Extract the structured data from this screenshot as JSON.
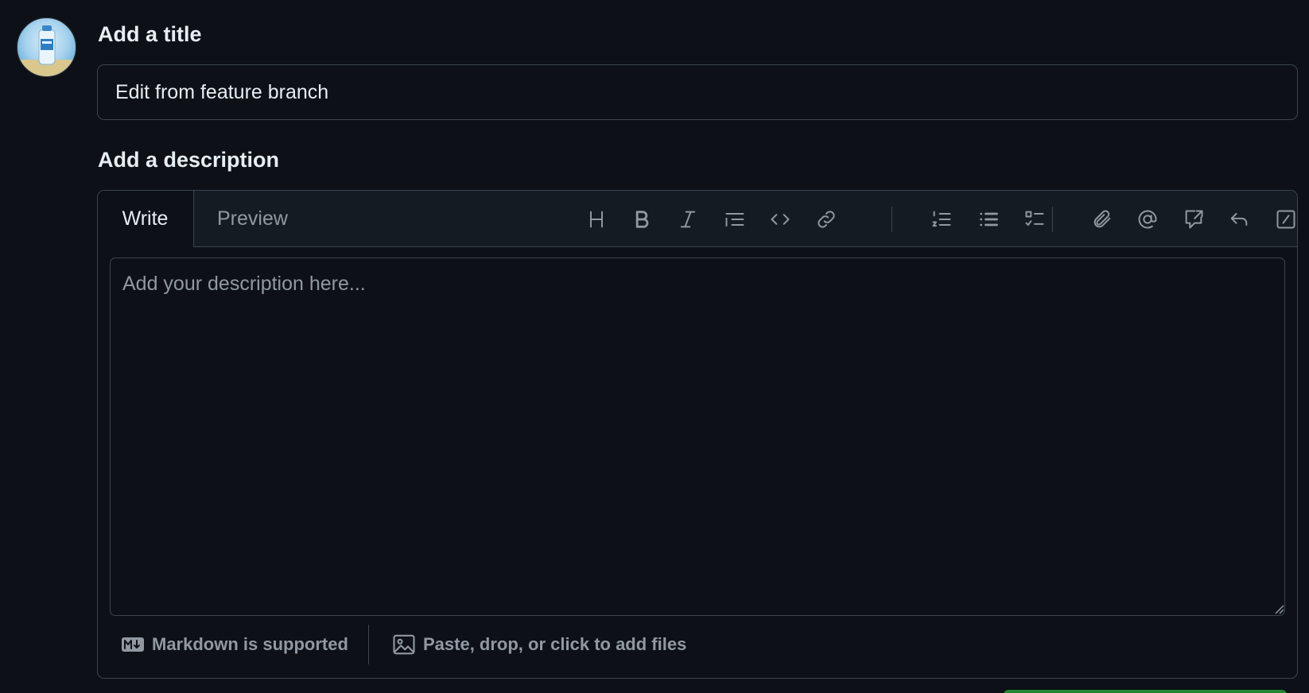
{
  "avatar": {
    "alt": "User avatar"
  },
  "title_section": {
    "heading": "Add a title",
    "value": "Edit from feature branch"
  },
  "description_section": {
    "heading": "Add a description",
    "tabs": [
      {
        "label": "Write",
        "active": true
      },
      {
        "label": "Preview",
        "active": false
      }
    ],
    "toolbar": [
      {
        "name": "heading-icon",
        "title": "Heading"
      },
      {
        "name": "bold-icon",
        "title": "Bold"
      },
      {
        "name": "italic-icon",
        "title": "Italic"
      },
      {
        "name": "quote-icon",
        "title": "Quote"
      },
      {
        "name": "code-icon",
        "title": "Code"
      },
      {
        "name": "link-icon",
        "title": "Link"
      },
      {
        "name": "ordered-list-icon",
        "title": "Numbered list"
      },
      {
        "name": "unordered-list-icon",
        "title": "Unordered list"
      },
      {
        "name": "task-list-icon",
        "title": "Task list"
      },
      {
        "name": "attach-icon",
        "title": "Attach files"
      },
      {
        "name": "mention-icon",
        "title": "Mention"
      },
      {
        "name": "reference-icon",
        "title": "Reference"
      },
      {
        "name": "saved-replies-icon",
        "title": "Saved replies"
      },
      {
        "name": "slash-commands-icon",
        "title": "Slash commands"
      }
    ],
    "placeholder": "Add your description here...",
    "value": "",
    "footer": {
      "markdown_label": "Markdown is supported",
      "files_label": "Paste, drop, or click to add files"
    }
  },
  "colors": {
    "background": "#0d1117",
    "header_background": "#151b23",
    "border": "#3d444d",
    "text": "#e6edf3",
    "muted": "#9198a1",
    "accent_green": "#238636"
  }
}
